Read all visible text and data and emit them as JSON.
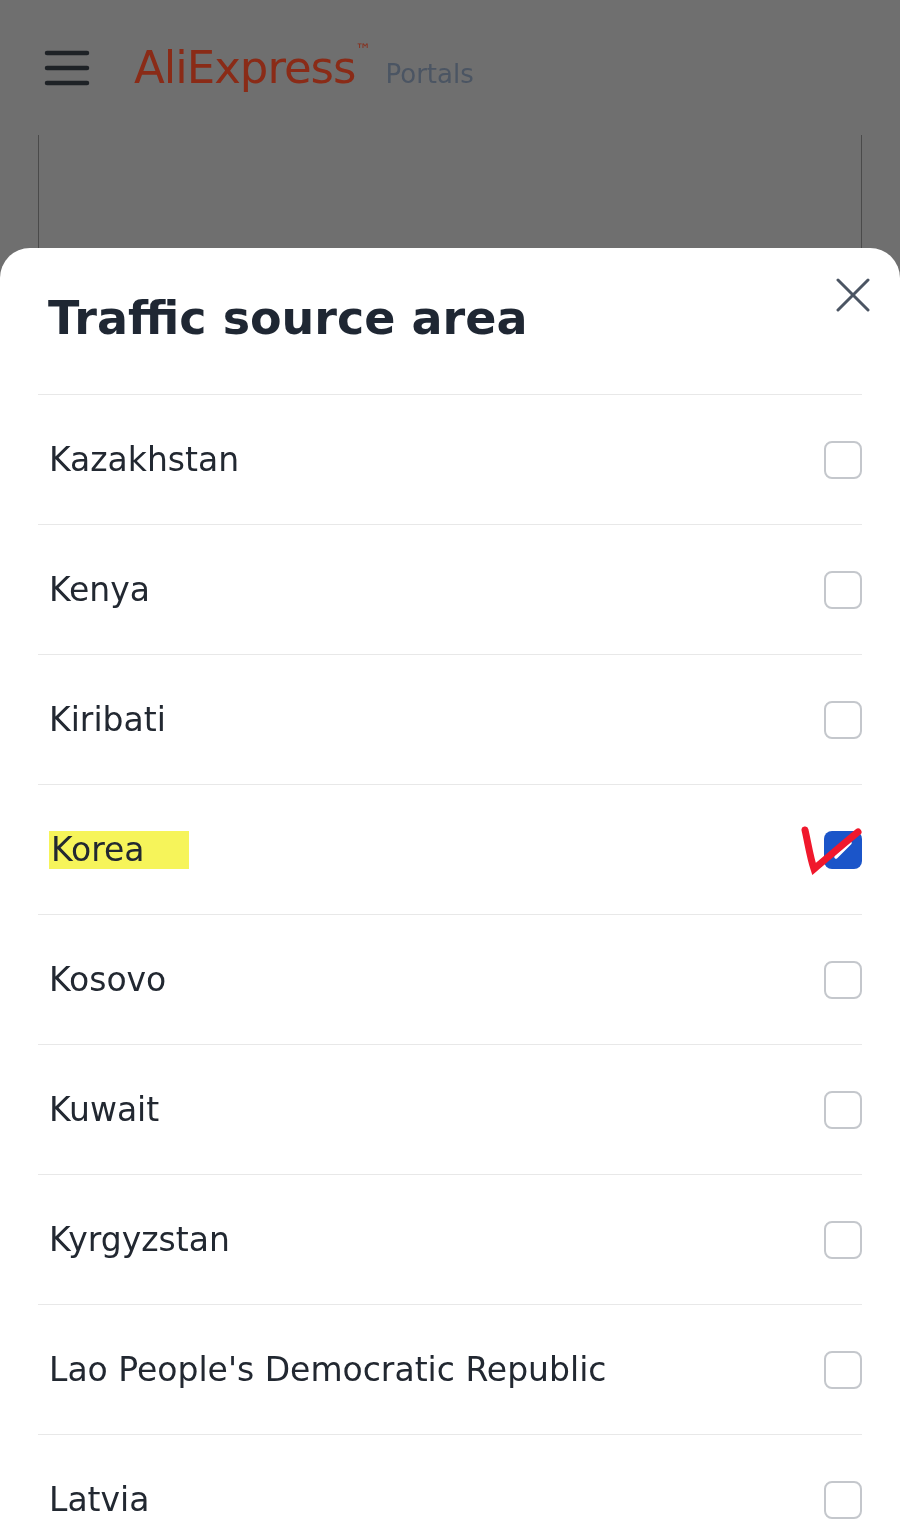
{
  "header": {
    "logo": "AliExpress",
    "logo_mark": "™",
    "subtitle": "Portals"
  },
  "sheet": {
    "title": "Traffic source area",
    "options": [
      {
        "label": "Kazakhstan",
        "checked": false,
        "highlighted": false,
        "hand_marked": false
      },
      {
        "label": "Kenya",
        "checked": false,
        "highlighted": false,
        "hand_marked": false
      },
      {
        "label": "Kiribati",
        "checked": false,
        "highlighted": false,
        "hand_marked": false
      },
      {
        "label": "Korea",
        "checked": true,
        "highlighted": true,
        "hand_marked": true
      },
      {
        "label": "Kosovo",
        "checked": false,
        "highlighted": false,
        "hand_marked": false
      },
      {
        "label": "Kuwait",
        "checked": false,
        "highlighted": false,
        "hand_marked": false
      },
      {
        "label": "Kyrgyzstan",
        "checked": false,
        "highlighted": false,
        "hand_marked": false
      },
      {
        "label": "Lao People's Democratic Republic",
        "checked": false,
        "highlighted": false,
        "hand_marked": false
      },
      {
        "label": "Latvia",
        "checked": false,
        "highlighted": false,
        "hand_marked": false
      }
    ]
  }
}
